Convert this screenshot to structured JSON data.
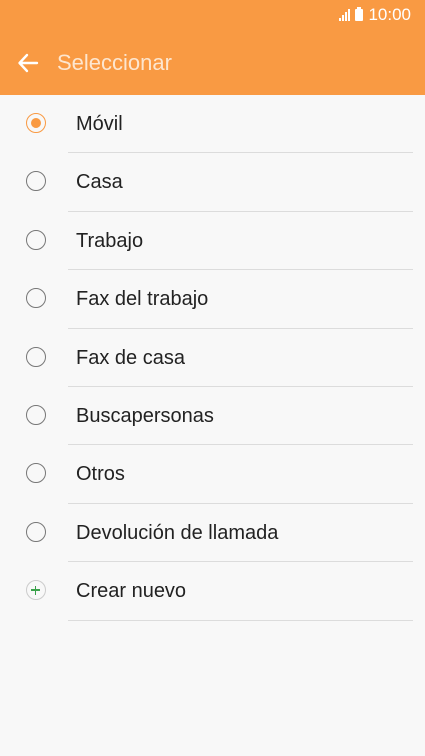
{
  "status_bar": {
    "time": "10:00"
  },
  "app_bar": {
    "title": "Seleccionar",
    "back_icon": "arrow-back-icon"
  },
  "colors": {
    "accent": "#f99a43",
    "add": "#3aa14a"
  },
  "options": [
    {
      "label": "Móvil",
      "selected": true
    },
    {
      "label": "Casa",
      "selected": false
    },
    {
      "label": "Trabajo",
      "selected": false
    },
    {
      "label": "Fax del trabajo",
      "selected": false
    },
    {
      "label": "Fax de casa",
      "selected": false
    },
    {
      "label": "Buscapersonas",
      "selected": false
    },
    {
      "label": "Otros",
      "selected": false
    },
    {
      "label": "Devolución de llamada",
      "selected": false
    }
  ],
  "create_new": {
    "label": "Crear nuevo",
    "icon": "plus-icon"
  }
}
